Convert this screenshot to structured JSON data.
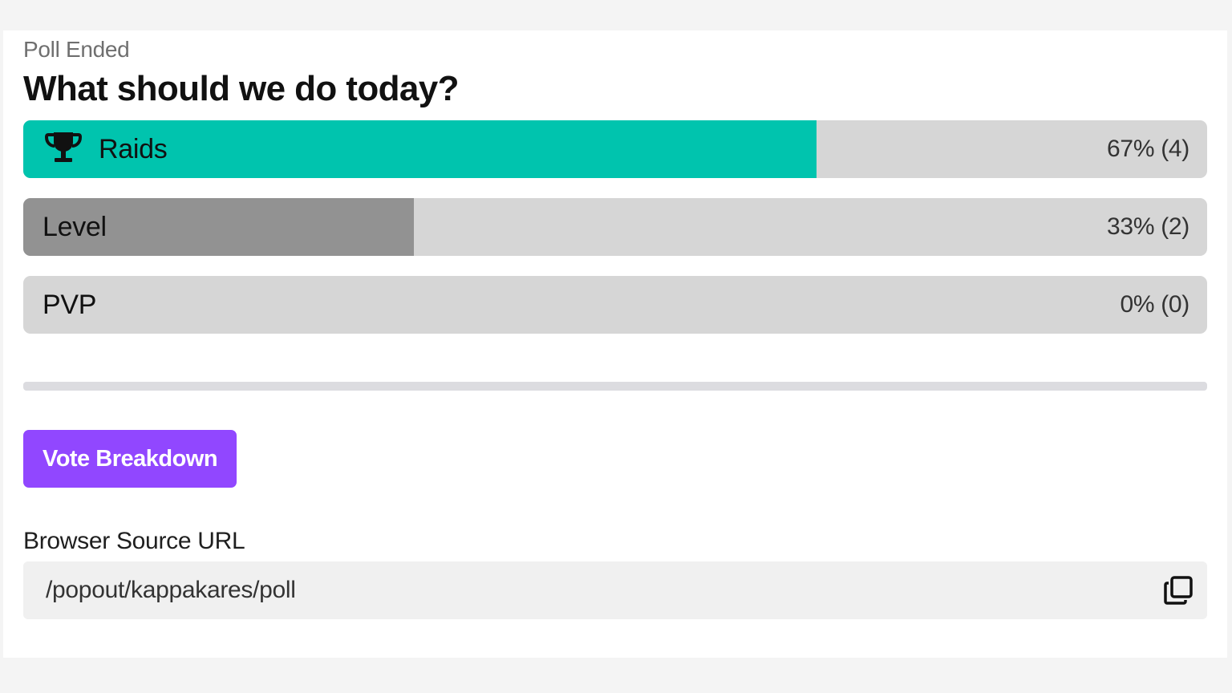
{
  "poll": {
    "status": "Poll Ended",
    "question": "What should we do today?",
    "options": [
      {
        "label": "Raids",
        "result": "67% (4)",
        "percent": 67,
        "votes": 4,
        "winner": true,
        "icon": "trophy-icon",
        "fill_color": "#00c4ae"
      },
      {
        "label": "Level",
        "result": "33% (2)",
        "percent": 33,
        "votes": 2,
        "winner": false,
        "fill_color": "#929292"
      },
      {
        "label": "PVP",
        "result": "0% (0)",
        "percent": 0,
        "votes": 0,
        "winner": false,
        "fill_color": "#929292"
      }
    ],
    "track_color": "#d6d6d6"
  },
  "actions": {
    "vote_breakdown_label": "Vote Breakdown",
    "button_color": "#9147ff"
  },
  "browser_source": {
    "label": "Browser Source URL",
    "value": "/popout/kappakares/poll",
    "copy_icon": "copy-icon"
  }
}
